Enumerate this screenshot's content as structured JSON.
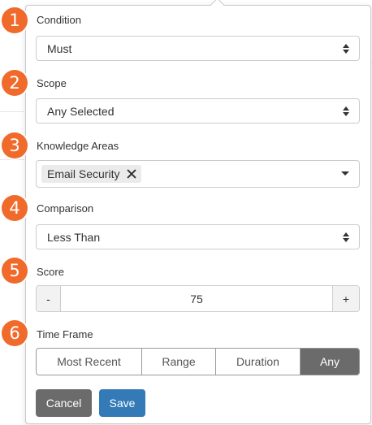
{
  "form": {
    "condition": {
      "label": "Condition",
      "value": "Must"
    },
    "scope": {
      "label": "Scope",
      "value": "Any Selected"
    },
    "knowledge_areas": {
      "label": "Knowledge Areas",
      "tags": [
        "Email Security"
      ]
    },
    "comparison": {
      "label": "Comparison",
      "value": "Less Than"
    },
    "score": {
      "label": "Score",
      "minus": "-",
      "value": "75",
      "plus": "+"
    },
    "time_frame": {
      "label": "Time Frame",
      "options": [
        "Most Recent",
        "Range",
        "Duration",
        "Any"
      ],
      "selected": "Any"
    },
    "actions": {
      "cancel": "Cancel",
      "save": "Save"
    }
  },
  "badges": [
    "1",
    "2",
    "3",
    "4",
    "5",
    "6"
  ],
  "colors": {
    "badge": "#f06a2b",
    "save_button": "#337ab7",
    "cancel_button": "#6b6b6b",
    "selected_segment": "#6b6b6b"
  },
  "icons": {
    "select_arrows": "up-down-arrows-icon",
    "tag_remove": "close-icon",
    "dropdown": "caret-down-icon"
  }
}
